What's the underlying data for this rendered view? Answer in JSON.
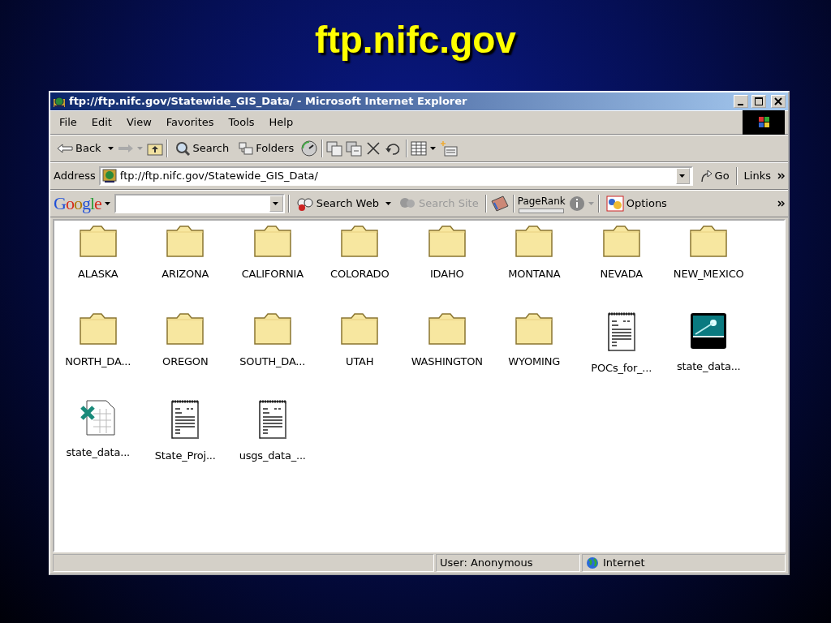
{
  "slide_title": "ftp.nifc.gov",
  "window": {
    "title": "ftp://ftp.nifc.gov/Statewide_GIS_Data/ - Microsoft Internet Explorer"
  },
  "menu": [
    "File",
    "Edit",
    "View",
    "Favorites",
    "Tools",
    "Help"
  ],
  "toolbar": {
    "back": "Back",
    "search": "Search",
    "folders": "Folders"
  },
  "address": {
    "label": "Address",
    "value": "ftp://ftp.nifc.gov/Statewide_GIS_Data/",
    "go": "Go",
    "links": "Links"
  },
  "google_bar": {
    "logo": "Google",
    "search_web": "Search Web",
    "search_site": {
      "label": "Search Site",
      "disabled": true
    },
    "pagerank": {
      "label": "PageRank",
      "level": 0
    },
    "options": "Options"
  },
  "files": [
    {
      "name": "ALASKA",
      "kind": "folder"
    },
    {
      "name": "ARIZONA",
      "kind": "folder"
    },
    {
      "name": "CALIFORNIA",
      "kind": "folder"
    },
    {
      "name": "COLORADO",
      "kind": "folder"
    },
    {
      "name": "IDAHO",
      "kind": "folder"
    },
    {
      "name": "MONTANA",
      "kind": "folder"
    },
    {
      "name": "NEVADA",
      "kind": "folder"
    },
    {
      "name": "NEW_MEXICO",
      "kind": "folder"
    },
    {
      "name": "NORTH_DA...",
      "kind": "folder"
    },
    {
      "name": "OREGON",
      "kind": "folder"
    },
    {
      "name": "SOUTH_DA...",
      "kind": "folder"
    },
    {
      "name": "UTAH",
      "kind": "folder"
    },
    {
      "name": "WASHINGTON",
      "kind": "folder"
    },
    {
      "name": "WYOMING",
      "kind": "folder"
    },
    {
      "name": "POCs_for_...",
      "kind": "text"
    },
    {
      "name": "state_data...",
      "kind": "netscape"
    },
    {
      "name": "state_data...",
      "kind": "spreadsheet"
    },
    {
      "name": "State_Proj...",
      "kind": "text"
    },
    {
      "name": "usgs_data_...",
      "kind": "text"
    }
  ],
  "status_bar": {
    "user": "User: Anonymous",
    "zone": "Internet"
  }
}
